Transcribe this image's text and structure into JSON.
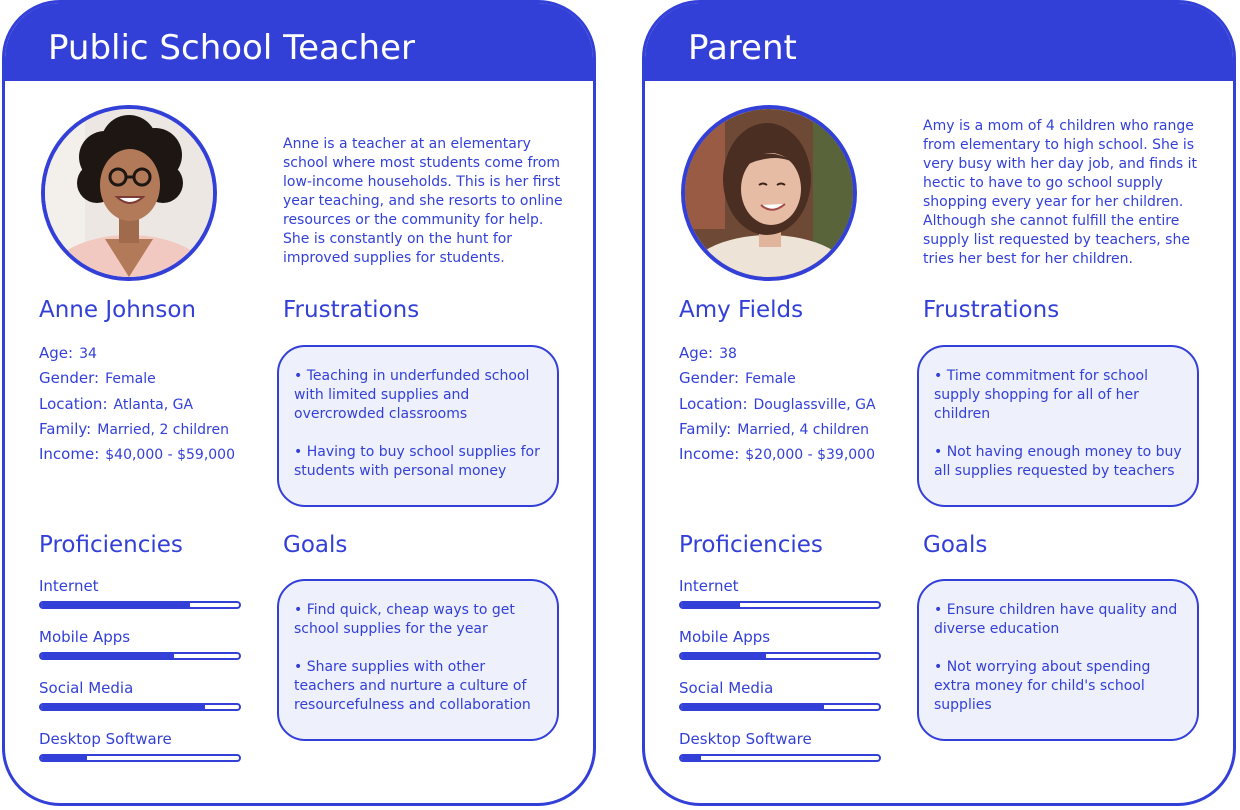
{
  "personas": [
    {
      "header": "Public School Teacher",
      "bio": "Anne is a teacher at an elementary school where most students come from low-income households. This is her first year teaching, and she resorts to online resources or the community for help. She is constantly on the hunt for improved supplies for students.",
      "name": "Anne Johnson",
      "facts": [
        {
          "label": "Age:",
          "value": "34"
        },
        {
          "label": "Gender:",
          "value": "Female"
        },
        {
          "label": "Location:",
          "value": "Atlanta, GA"
        },
        {
          "label": "Family:",
          "value": "Married, 2 children"
        },
        {
          "label": "Income:",
          "value": "$40,000 - $59,000"
        }
      ],
      "frustrations_title": "Frustrations",
      "frustrations": [
        "• Teaching in underfunded school with limited supplies and overcrowded classrooms",
        "• Having to buy school supplies for students with personal money"
      ],
      "proficiencies_title": "Proficiencies",
      "proficiencies": [
        {
          "label": "Internet",
          "level": 0.75
        },
        {
          "label": "Mobile Apps",
          "level": 0.67
        },
        {
          "label": "Social Media",
          "level": 0.83
        },
        {
          "label": "Desktop Software",
          "level": 0.23
        }
      ],
      "goals_title": "Goals",
      "goals": [
        "• Find quick, cheap ways to get school supplies for the year",
        "• Share supplies with other teachers and nurture a culture of resourcefulness and collaboration"
      ]
    },
    {
      "header": "Parent",
      "bio": "Amy is a mom of 4 children who range from elementary to high school. She is very busy with her day job, and finds it hectic to have to go school supply shopping every year for her children. Although she cannot fulfill the entire supply list requested by teachers, she tries her best for her children.",
      "name": "Amy Fields",
      "facts": [
        {
          "label": "Age:",
          "value": "38"
        },
        {
          "label": "Gender:",
          "value": "Female"
        },
        {
          "label": "Location:",
          "value": "Douglassville, GA"
        },
        {
          "label": "Family:",
          "value": "Married, 4 children"
        },
        {
          "label": "Income:",
          "value": "$20,000 - $39,000"
        }
      ],
      "frustrations_title": "Frustrations",
      "frustrations": [
        "• Time commitment for school supply shopping for all of her children",
        "• Not having enough money to buy all supplies requested by teachers"
      ],
      "proficiencies_title": "Proficiencies",
      "proficiencies": [
        {
          "label": "Internet",
          "level": 0.3
        },
        {
          "label": "Mobile Apps",
          "level": 0.43
        },
        {
          "label": "Social Media",
          "level": 0.72
        },
        {
          "label": "Desktop Software",
          "level": 0.1
        }
      ],
      "goals_title": "Goals",
      "goals": [
        "• Ensure children have quality and diverse education",
        "• Not worrying about spending extra money for child's school supplies"
      ]
    }
  ],
  "colors": {
    "accent": "#3340d8",
    "box_fill": "#eef0fb"
  }
}
